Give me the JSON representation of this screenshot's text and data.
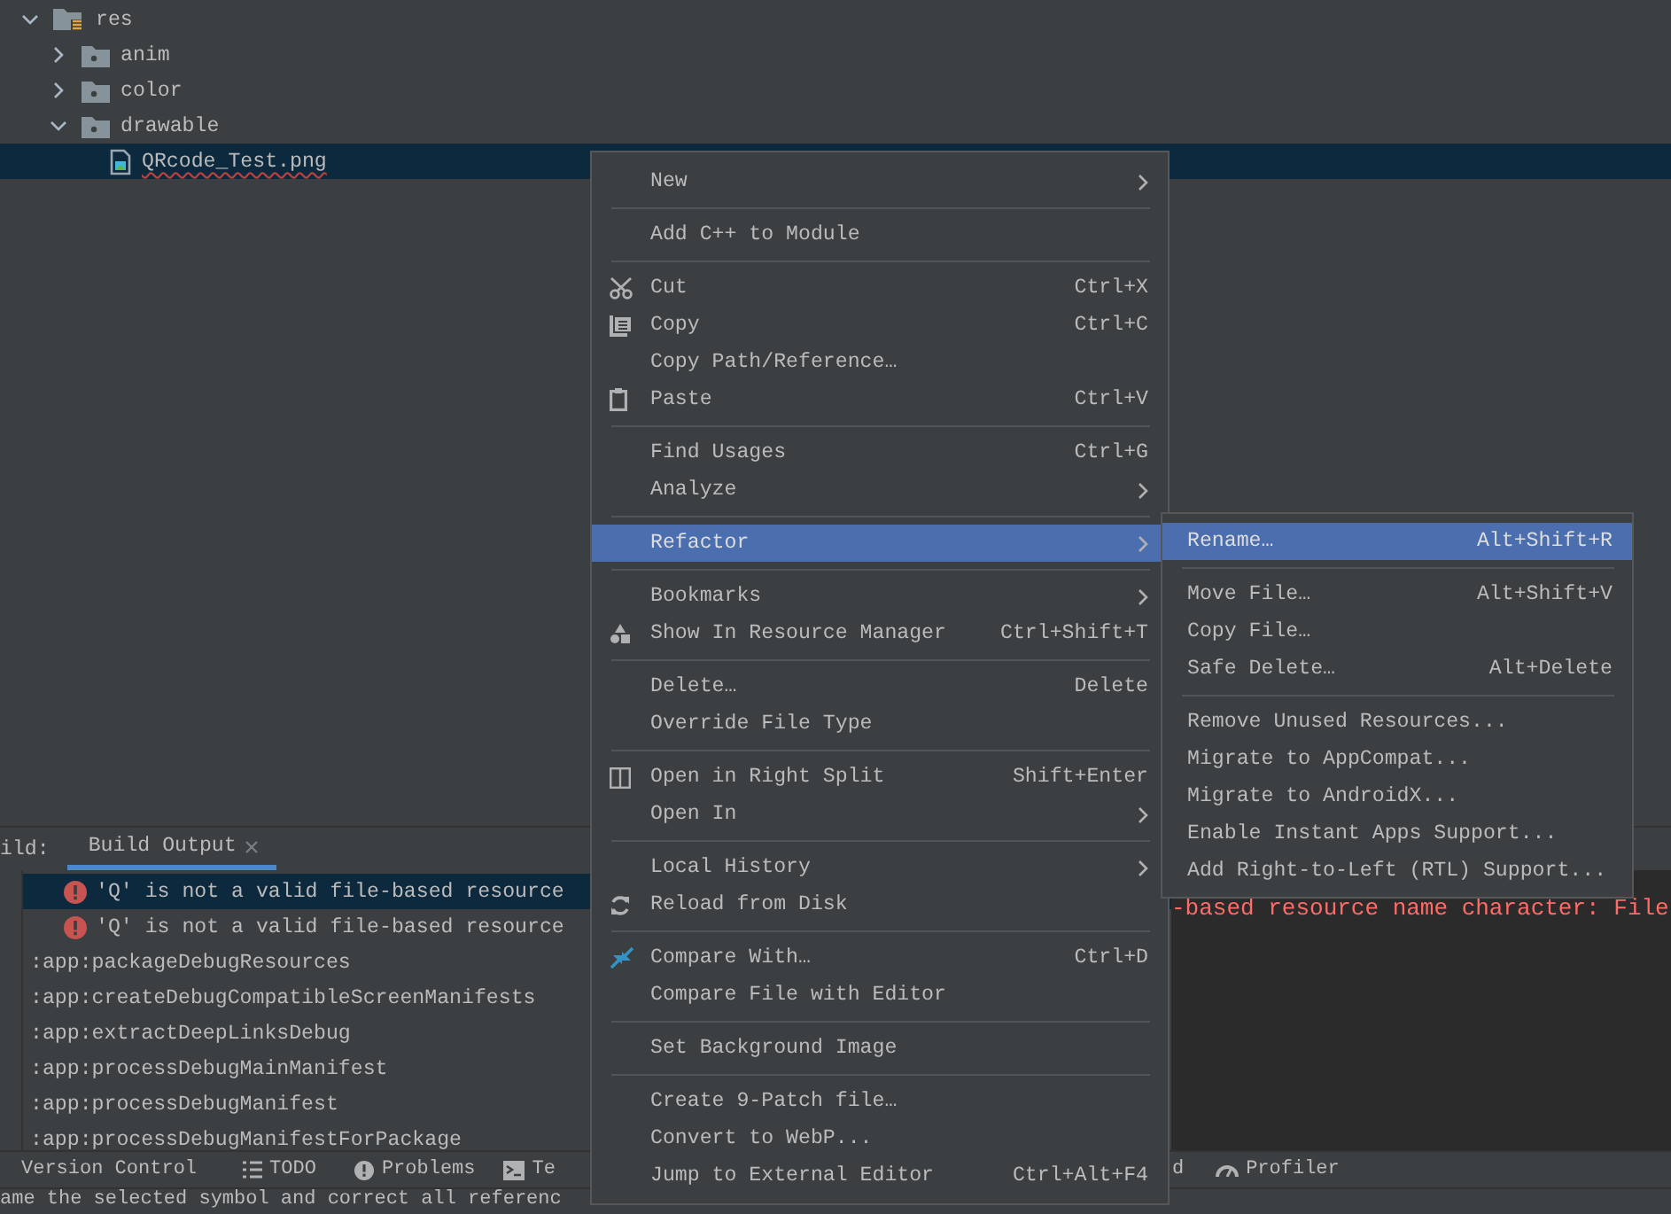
{
  "project_tree": [
    {
      "label": "res",
      "kind": "res-folder",
      "expanded": true,
      "selected": false,
      "error_underline": false,
      "children": [
        {
          "label": "anim",
          "kind": "folder",
          "expanded": false,
          "selected": false,
          "error_underline": false
        },
        {
          "label": "color",
          "kind": "folder",
          "expanded": false,
          "selected": false,
          "error_underline": false
        },
        {
          "label": "drawable",
          "kind": "folder",
          "expanded": true,
          "selected": false,
          "error_underline": false,
          "children": [
            {
              "label": "QRcode_Test.png",
              "kind": "image-file",
              "selected": true,
              "error_underline": true
            }
          ]
        }
      ]
    }
  ],
  "build_panel": {
    "label": "ild:",
    "tabs": [
      {
        "label": "Build Output",
        "selected": true,
        "closable": true
      }
    ],
    "rows": [
      {
        "kind": "error",
        "text": "'Q' is not a valid file-based resource",
        "selected": true
      },
      {
        "kind": "error",
        "text": "'Q' is not a valid file-based resource",
        "selected": false
      },
      {
        "kind": "task",
        "text": ":app:packageDebugResources",
        "selected": false
      },
      {
        "kind": "task",
        "text": ":app:createDebugCompatibleScreenManifests",
        "selected": false
      },
      {
        "kind": "task",
        "text": ":app:extractDeepLinksDebug",
        "selected": false
      },
      {
        "kind": "task",
        "text": ":app:processDebugMainManifest",
        "selected": false
      },
      {
        "kind": "task",
        "text": ":app:processDebugManifest",
        "selected": false
      },
      {
        "kind": "task",
        "text": ":app:processDebugManifestForPackage",
        "selected": false
      }
    ],
    "detail_text": "-based resource name character: File"
  },
  "tool_tabs": [
    {
      "label": "Version Control"
    },
    {
      "label": "TODO"
    },
    {
      "label": "Problems"
    },
    {
      "label": "Te"
    },
    {
      "label": "d"
    },
    {
      "label": "Profiler"
    }
  ],
  "status_bar": {
    "text": "ame the selected symbol and correct all referenc"
  },
  "context_menu": {
    "items": [
      {
        "kind": "item",
        "label": "New",
        "has_submenu": true,
        "selected": false
      },
      {
        "kind": "separator"
      },
      {
        "kind": "item",
        "label": "Add C++ to Module",
        "has_submenu": false,
        "selected": false
      },
      {
        "kind": "separator"
      },
      {
        "kind": "item",
        "label": "Cut",
        "shortcut": "Ctrl+X",
        "has_submenu": false,
        "selected": false
      },
      {
        "kind": "item",
        "label": "Copy",
        "shortcut": "Ctrl+C",
        "has_submenu": false,
        "selected": false
      },
      {
        "kind": "item",
        "label": "Copy Path/Reference…",
        "has_submenu": false,
        "selected": false
      },
      {
        "kind": "item",
        "label": "Paste",
        "shortcut": "Ctrl+V",
        "has_submenu": false,
        "selected": false
      },
      {
        "kind": "separator"
      },
      {
        "kind": "item",
        "label": "Find Usages",
        "shortcut": "Ctrl+G",
        "has_submenu": false,
        "selected": false
      },
      {
        "kind": "item",
        "label": "Analyze",
        "has_submenu": true,
        "selected": false
      },
      {
        "kind": "separator"
      },
      {
        "kind": "item",
        "label": "Refactor",
        "has_submenu": true,
        "selected": true
      },
      {
        "kind": "separator"
      },
      {
        "kind": "item",
        "label": "Bookmarks",
        "has_submenu": true,
        "selected": false
      },
      {
        "kind": "item",
        "label": "Show In Resource Manager",
        "shortcut": "Ctrl+Shift+T",
        "has_submenu": false,
        "selected": false
      },
      {
        "kind": "separator"
      },
      {
        "kind": "item",
        "label": "Delete…",
        "shortcut": "Delete",
        "has_submenu": false,
        "selected": false
      },
      {
        "kind": "item",
        "label": "Override File Type",
        "has_submenu": false,
        "selected": false
      },
      {
        "kind": "separator"
      },
      {
        "kind": "item",
        "label": "Open in Right Split",
        "shortcut": "Shift+Enter",
        "has_submenu": false,
        "selected": false
      },
      {
        "kind": "item",
        "label": "Open In",
        "has_submenu": true,
        "selected": false
      },
      {
        "kind": "separator"
      },
      {
        "kind": "item",
        "label": "Local History",
        "has_submenu": true,
        "selected": false
      },
      {
        "kind": "item",
        "label": "Reload from Disk",
        "has_submenu": false,
        "selected": false
      },
      {
        "kind": "separator"
      },
      {
        "kind": "item",
        "label": "Compare With…",
        "shortcut": "Ctrl+D",
        "has_submenu": false,
        "selected": false
      },
      {
        "kind": "item",
        "label": "Compare File with Editor",
        "has_submenu": false,
        "selected": false
      },
      {
        "kind": "separator"
      },
      {
        "kind": "item",
        "label": "Set Background Image",
        "has_submenu": false,
        "selected": false
      },
      {
        "kind": "separator"
      },
      {
        "kind": "item",
        "label": "Create 9-Patch file…",
        "has_submenu": false,
        "selected": false
      },
      {
        "kind": "item",
        "label": "Convert to WebP...",
        "has_submenu": false,
        "selected": false
      },
      {
        "kind": "item",
        "label": "Jump to External Editor",
        "shortcut": "Ctrl+Alt+F4",
        "has_submenu": false,
        "selected": false
      }
    ]
  },
  "refactor_submenu": {
    "items": [
      {
        "kind": "item",
        "label": "Rename…",
        "shortcut": "Alt+Shift+R",
        "selected": true
      },
      {
        "kind": "separator"
      },
      {
        "kind": "item",
        "label": "Move File…",
        "shortcut": "Alt+Shift+V",
        "selected": false
      },
      {
        "kind": "item",
        "label": "Copy File…",
        "selected": false
      },
      {
        "kind": "item",
        "label": "Safe Delete…",
        "shortcut": "Alt+Delete",
        "selected": false
      },
      {
        "kind": "separator"
      },
      {
        "kind": "item",
        "label": "Remove Unused Resources...",
        "selected": false
      },
      {
        "kind": "item",
        "label": "Migrate to AppCompat...",
        "selected": false
      },
      {
        "kind": "item",
        "label": "Migrate to AndroidX...",
        "selected": false
      },
      {
        "kind": "item",
        "label": "Enable Instant Apps Support...",
        "selected": false
      },
      {
        "kind": "item",
        "label": "Add Right-to-Left (RTL) Support...",
        "selected": false
      }
    ]
  }
}
